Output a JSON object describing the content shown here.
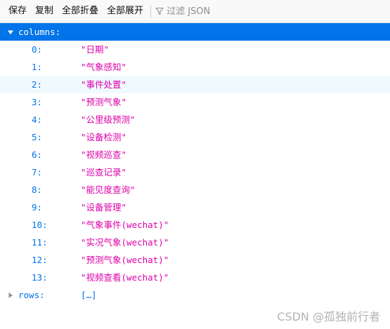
{
  "toolbar": {
    "save_label": "保存",
    "copy_label": "复制",
    "collapse_all_label": "全部折叠",
    "expand_all_label": "全部展开",
    "filter_placeholder": "过滤 JSON",
    "filter_icon": "funnel-icon"
  },
  "tree": {
    "root_key": "columns:",
    "root_expanded": true,
    "items": [
      {
        "index": "0:",
        "value": "\"日期\""
      },
      {
        "index": "1:",
        "value": "\"气象感知\""
      },
      {
        "index": "2:",
        "value": "\"事件处置\""
      },
      {
        "index": "3:",
        "value": "\"预测气象\""
      },
      {
        "index": "4:",
        "value": "\"公里级预测\""
      },
      {
        "index": "5:",
        "value": "\"设备检测\""
      },
      {
        "index": "6:",
        "value": "\"视频巡查\""
      },
      {
        "index": "7:",
        "value": "\"巡查记录\""
      },
      {
        "index": "8:",
        "value": "\"能见度查询\""
      },
      {
        "index": "9:",
        "value": "\"设备管理\""
      },
      {
        "index": "10:",
        "value": "\"气象事件(wechat)\""
      },
      {
        "index": "11:",
        "value": "\"实况气象(wechat)\""
      },
      {
        "index": "12:",
        "value": "\"预测气象(wechat)\""
      },
      {
        "index": "13:",
        "value": "\"视频查看(wechat)\""
      }
    ],
    "rows_key": "rows:",
    "rows_value": "[…]",
    "rows_expanded": false
  },
  "watermark": "CSDN @孤独前行者",
  "colors": {
    "selected_bg": "#0074e8",
    "key": "#0074e8",
    "string": "#dd00a9",
    "hover_bg": "#f0f9fe"
  }
}
